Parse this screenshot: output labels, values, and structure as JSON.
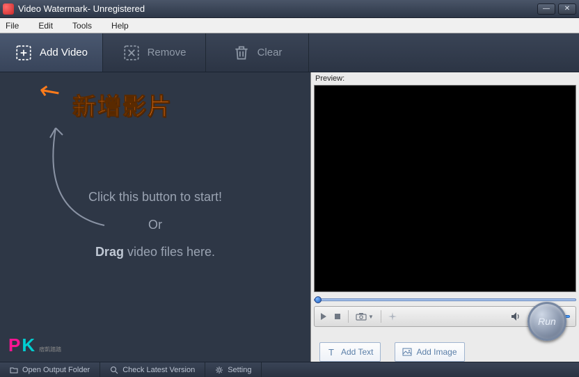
{
  "window": {
    "title": "Video Watermark- Unregistered"
  },
  "menu": {
    "file": "File",
    "edit": "Edit",
    "tools": "Tools",
    "help": "Help"
  },
  "toolbar": {
    "add_video": "Add Video",
    "remove": "Remove",
    "clear": "Clear"
  },
  "annotation": {
    "text": "新增影片"
  },
  "hint": {
    "line1": "Click this button to start!",
    "line2": "Or",
    "drag_b": "Drag",
    "drag_rest": " video files here."
  },
  "logo": {
    "p": "P",
    "k": "K",
    "sub": "痞凱踏踏"
  },
  "preview": {
    "label": "Preview:"
  },
  "actions": {
    "add_text": "Add Text",
    "add_image": "Add Image",
    "run": "Run"
  },
  "status": {
    "open_output": "Open Output Folder",
    "check_version": "Check Latest Version",
    "setting": "Setting"
  }
}
